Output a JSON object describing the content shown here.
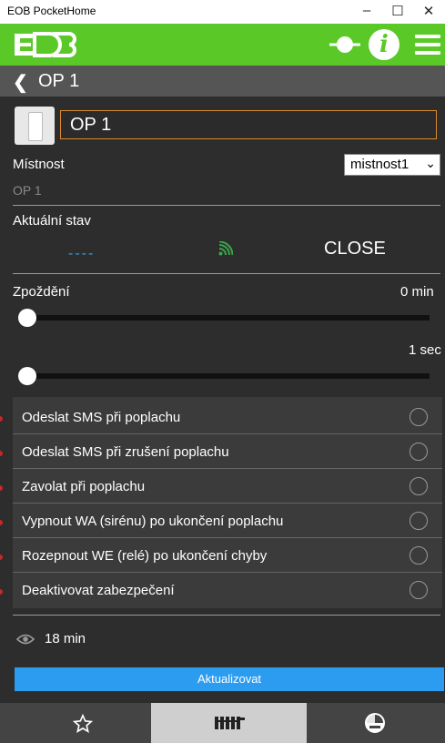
{
  "window": {
    "title": "EOB PocketHome",
    "minimize": "–",
    "maximize": "☐",
    "close": "✕"
  },
  "header": {
    "logo": "EOB",
    "info_glyph": "i"
  },
  "subheader": {
    "back_glyph": "❮",
    "title": "OP 1"
  },
  "device": {
    "name": "OP 1"
  },
  "room": {
    "label": "Místnost",
    "value": "OP 1",
    "selected_option": "mistnost1"
  },
  "status": {
    "label": "Aktuální stav",
    "value": "----",
    "state": "CLOSE"
  },
  "delay": {
    "label": "Zpoždění",
    "value1": "0 min",
    "value2": "1 sec",
    "level1": 0,
    "level2": 0
  },
  "alarm_options": [
    {
      "label": "Odeslat SMS při poplachu"
    },
    {
      "label": "Odeslat SMS při zrušení poplachu"
    },
    {
      "label": "Zavolat při poplachu"
    },
    {
      "label": "Vypnout WA (sirénu) po ukončení poplachu"
    },
    {
      "label": "Rozepnout WE (relé) po ukončení chyby"
    },
    {
      "label": "Deaktivovat zabezpečení"
    }
  ],
  "last_seen": "18 min",
  "update_button": "Aktualizovat",
  "colors": {
    "accent_green": "#5ac927",
    "button_blue": "#2b9cf0",
    "field_border": "#d98a2b",
    "signal_green": "#3aa54a"
  },
  "bottom_nav": [
    "star-icon",
    "radiator-icon",
    "gauge-icon"
  ]
}
